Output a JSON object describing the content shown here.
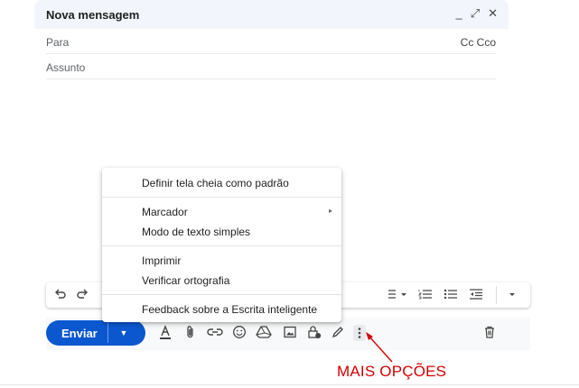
{
  "compose": {
    "title": "Nova mensagem",
    "header_controls": {
      "minimize": "_",
      "fullscreen": "⤢",
      "close": "✕"
    },
    "to_label": "Para",
    "cc_bcc": "Cc Cco",
    "subject_placeholder": "Assunto"
  },
  "format_toolbar": {
    "icons": [
      "undo-icon",
      "redo-icon",
      "align-dropdown-icon",
      "numbered-list-icon",
      "bulleted-list-icon",
      "indent-less-icon",
      "more-formatting-icon"
    ]
  },
  "bottom_bar": {
    "send_label": "Enviar",
    "send_options": "▼",
    "tools": [
      "formatting-options-icon",
      "attach-icon",
      "link-icon",
      "emoji-icon",
      "drive-icon",
      "photo-icon",
      "confidential-icon",
      "signature-icon",
      "more-options-icon"
    ],
    "discard": "discard-icon",
    "accent_color": "#0b57d0"
  },
  "menu": {
    "items": [
      "Definir tela cheia como padrão",
      "Marcador",
      "Modo de texto simples",
      "Imprimir",
      "Verificar ortografia",
      "Feedback sobre a Escrita inteligente"
    ],
    "submenu_arrow": "▸"
  },
  "annotation": {
    "text": "MAIS OPÇÕES",
    "color": "#d00000"
  }
}
